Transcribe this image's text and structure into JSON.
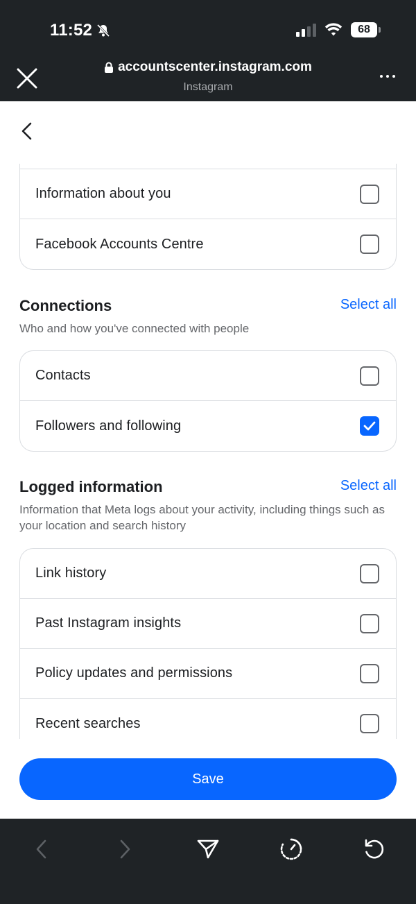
{
  "status_bar": {
    "time": "11:52",
    "battery": "68"
  },
  "browser": {
    "url": "accountscenter.instagram.com",
    "site_name": "Instagram"
  },
  "top_card": {
    "items": [
      {
        "label": "Information about you",
        "checked": false
      },
      {
        "label": "Facebook Accounts Centre",
        "checked": false
      }
    ]
  },
  "connections": {
    "title": "Connections",
    "select_all": "Select all",
    "description": "Who and how you've connected with people",
    "items": [
      {
        "label": "Contacts",
        "checked": false
      },
      {
        "label": "Followers and following",
        "checked": true
      }
    ]
  },
  "logged_information": {
    "title": "Logged information",
    "select_all": "Select all",
    "description": "Information that Meta logs about your activity, including things such as your location and search history",
    "items": [
      {
        "label": "Link history",
        "checked": false
      },
      {
        "label": "Past Instagram insights",
        "checked": false
      },
      {
        "label": "Policy updates and permissions",
        "checked": false
      },
      {
        "label": "Recent searches",
        "checked": false
      }
    ]
  },
  "save_label": "Save",
  "colors": {
    "accent": "#0866ff",
    "chrome": "#1f2326",
    "border": "#dadde1",
    "muted_text": "#65676b"
  },
  "icons": {
    "close": "close-icon",
    "lock": "lock-icon",
    "more": "more-icon",
    "back": "chevron-left-icon",
    "browser_back": "arrow-left-icon",
    "browser_forward": "arrow-right-icon",
    "share": "send-icon",
    "timer": "timer-icon",
    "refresh": "refresh-icon"
  }
}
